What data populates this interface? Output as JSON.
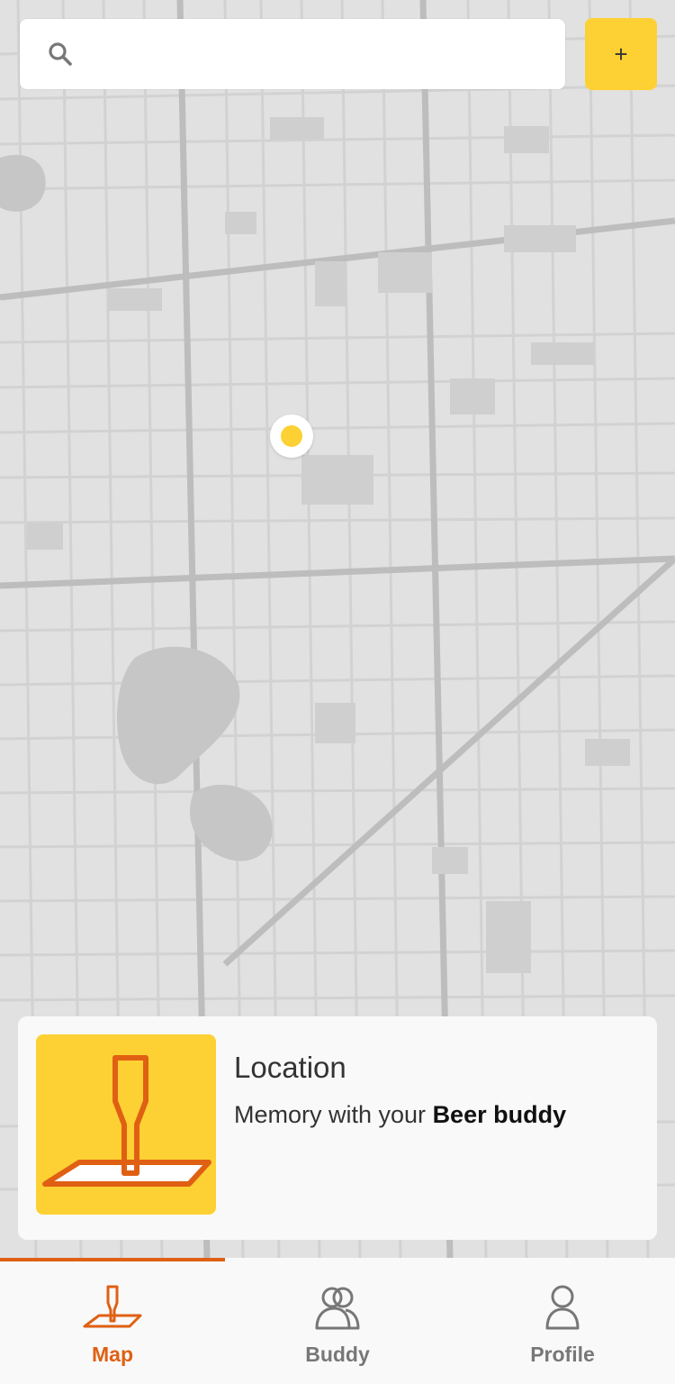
{
  "search": {
    "placeholder": "",
    "value": "",
    "icon": "search-icon"
  },
  "add_button": {
    "label": "+"
  },
  "map": {
    "marker_color": "#fdd134"
  },
  "card": {
    "title": "Location",
    "subtitle_prefix": "Memory with your ",
    "subtitle_highlight": "Beer buddy",
    "thumbnail_icon": "beer-tap-icon"
  },
  "tabs": [
    {
      "label": "Map",
      "icon": "map-icon",
      "active": true
    },
    {
      "label": "Buddy",
      "icon": "buddy-icon",
      "active": false
    },
    {
      "label": "Profile",
      "icon": "profile-icon",
      "active": false
    }
  ],
  "colors": {
    "accent": "#e06013",
    "brand": "#fdd134",
    "tab_inactive": "#777777"
  }
}
